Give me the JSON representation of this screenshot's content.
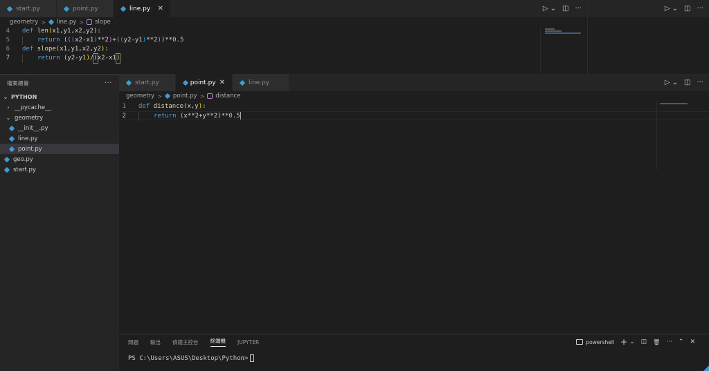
{
  "top_editor": {
    "tabs": [
      {
        "label": "start.py",
        "active": false
      },
      {
        "label": "point.py",
        "active": false
      },
      {
        "label": "line.py",
        "active": true
      }
    ],
    "close_glyph": "✕",
    "breadcrumb": {
      "folder": "geometry",
      "file": "line.py",
      "symbol": "slope"
    },
    "lines": [
      {
        "num": "4",
        "text": "def len(x1,y1,x2,y2):"
      },
      {
        "num": "5",
        "text": "    return (((x2-x1)**2)+((y2-y1)**2))**0.5"
      },
      {
        "num": "6",
        "text": "def slope(x1,y1,x2,y2):"
      },
      {
        "num": "7",
        "text": "    return (y2-y1)/(x2-x1)"
      }
    ]
  },
  "sidebar": {
    "header": "檔案總管",
    "more": "···",
    "section": "PYTHON",
    "items": [
      {
        "label": "__pycache__",
        "type": "folder",
        "expanded": false
      },
      {
        "label": "geometry",
        "type": "folder",
        "expanded": true
      },
      {
        "label": "__init__.py",
        "type": "file"
      },
      {
        "label": "line.py",
        "type": "file"
      },
      {
        "label": "point.py",
        "type": "file",
        "selected": true
      },
      {
        "label": "geo.py",
        "type": "file"
      },
      {
        "label": "start.py",
        "type": "file"
      }
    ]
  },
  "bottom_editor": {
    "tabs": [
      {
        "label": "start.py",
        "active": false
      },
      {
        "label": "point.py",
        "active": true
      },
      {
        "label": "line.py",
        "active": false
      }
    ],
    "close_glyph": "✕",
    "breadcrumb": {
      "folder": "geometry",
      "file": "point.py",
      "symbol": "distance"
    },
    "lines": [
      {
        "num": "1",
        "text": "def distance(x,y):"
      },
      {
        "num": "2",
        "text": "    return (x**2+y**2)**0.5"
      }
    ]
  },
  "panel": {
    "tabs": [
      "問題",
      "輸出",
      "偵錯主控台",
      "終端機",
      "JUPYTER"
    ],
    "active_tab": "終端機",
    "shell": "powershell",
    "prompt": "PS C:\\Users\\ASUS\\Desktop\\Python>"
  },
  "icons": {
    "run": "▷",
    "chevron": "⌄",
    "split": "◫",
    "more": "···",
    "add": "+",
    "trash": "🗑",
    "up": "⌃",
    "close": "✕"
  },
  "colors": {
    "accent": "#3f9bd6",
    "keyword": "#569cd6",
    "function": "#dcdcaa",
    "number": "#b5cea8"
  }
}
